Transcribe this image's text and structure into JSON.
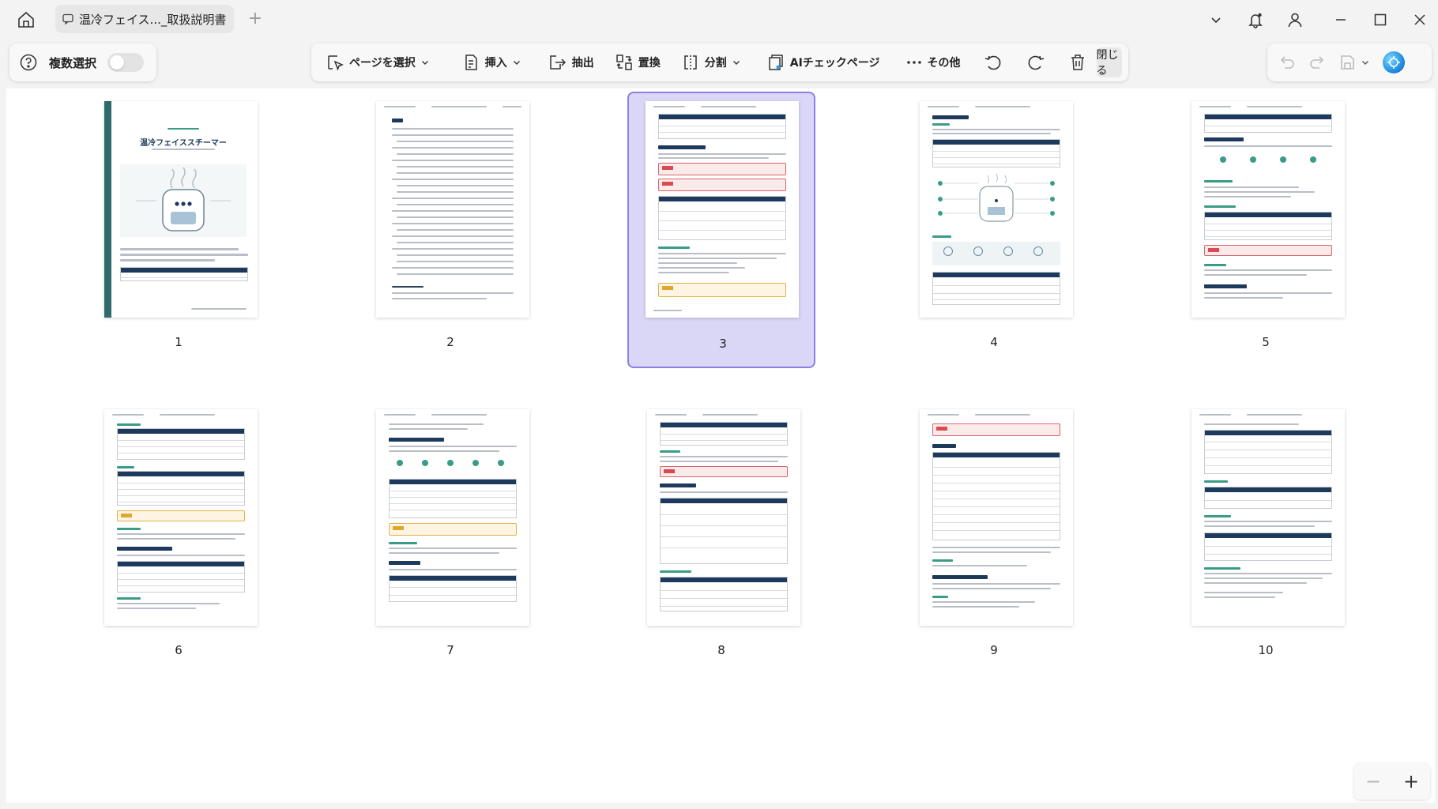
{
  "titlebar": {
    "tab_title": "温冷フェイス..._取扱説明書",
    "add_tab": "+"
  },
  "toolbar_left": {
    "multi_select_label": "複数選択",
    "multi_select_on": false
  },
  "toolbar_main": {
    "select_page": "ページを選択",
    "insert": "挿入",
    "extract": "抽出",
    "replace": "置換",
    "split": "分割",
    "ai_check": "AIチェックページ",
    "more": "その他",
    "close": "閉じる"
  },
  "cover": {
    "title": "温冷フェイススチーマー"
  },
  "pages": [
    {
      "number": "1",
      "selected": false
    },
    {
      "number": "2",
      "selected": false
    },
    {
      "number": "3",
      "selected": true
    },
    {
      "number": "4",
      "selected": false
    },
    {
      "number": "5",
      "selected": false
    },
    {
      "number": "6",
      "selected": false
    },
    {
      "number": "7",
      "selected": false
    },
    {
      "number": "8",
      "selected": false
    },
    {
      "number": "9",
      "selected": false
    },
    {
      "number": "10",
      "selected": false
    }
  ],
  "zoom": {
    "minus": "−",
    "plus": "+"
  },
  "colors": {
    "selection_fill": "#d9d6f6",
    "selection_border": "#8b80e3",
    "table_header": "#1d3a5c",
    "accent_green": "#3a9c86",
    "warning_red": "#d94a52"
  }
}
